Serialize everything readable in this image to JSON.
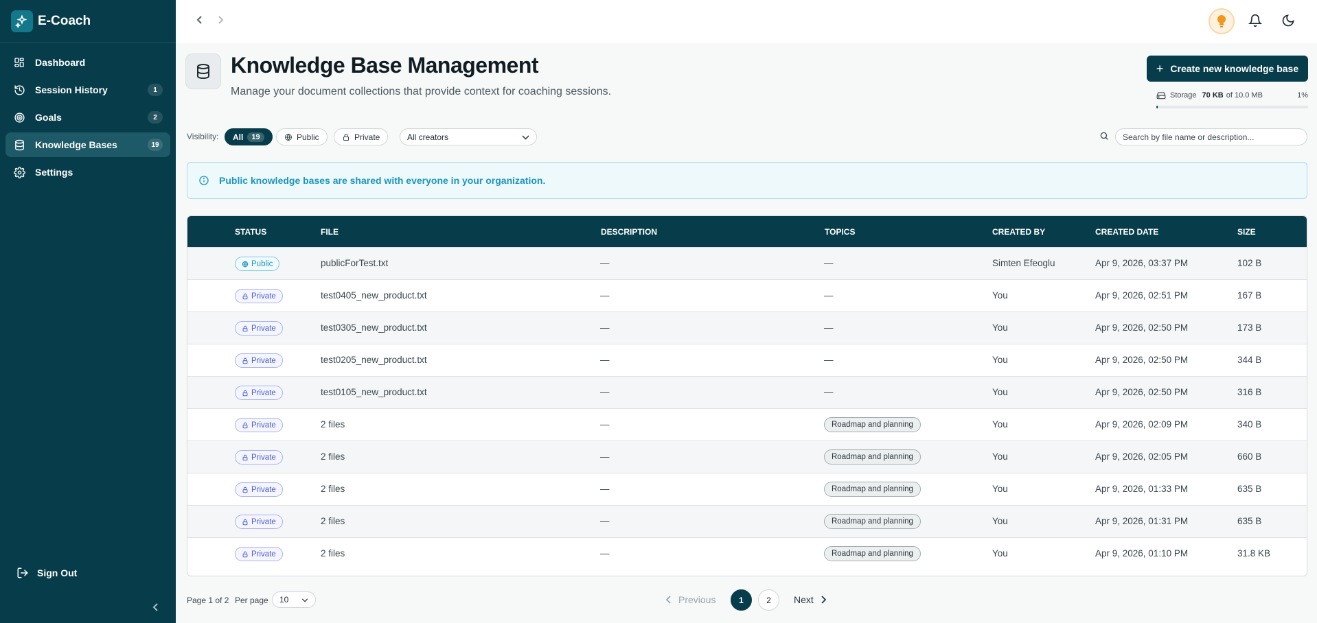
{
  "app": {
    "name": "E-Coach"
  },
  "sidebar": {
    "items": [
      {
        "label": "Dashboard",
        "badge": ""
      },
      {
        "label": "Session History",
        "badge": "1"
      },
      {
        "label": "Goals",
        "badge": "2"
      },
      {
        "label": "Knowledge Bases",
        "badge": "19"
      },
      {
        "label": "Settings",
        "badge": ""
      }
    ],
    "sign_out": "Sign Out"
  },
  "header": {
    "title": "Knowledge Base Management",
    "subtitle": "Manage your document collections that provide context for coaching sessions.",
    "create_button": "Create new knowledge base",
    "storage": {
      "label": "Storage",
      "used": "70 KB",
      "total": "of 10.0 MB",
      "percent": "1%",
      "fraction": 0.01
    }
  },
  "filters": {
    "visibility_label": "Visibility:",
    "all_label": "All",
    "all_count": "19",
    "public_label": "Public",
    "private_label": "Private",
    "creator_select": "All creators",
    "search_placeholder": "Search by file name or description..."
  },
  "banner": {
    "text": "Public knowledge bases are shared with everyone in your organization."
  },
  "table": {
    "columns": [
      "Status",
      "File",
      "Description",
      "Topics",
      "Created By",
      "Created Date",
      "Size"
    ],
    "rows": [
      {
        "status": "Public",
        "file": "publicForTest.txt",
        "description": "—",
        "topics": "—",
        "created_by": "Simten Efeoglu",
        "created_date": "Apr 9, 2026, 03:37 PM",
        "size": "102 B"
      },
      {
        "status": "Private",
        "file": "test0405_new_product.txt",
        "description": "—",
        "topics": "—",
        "created_by": "You",
        "created_date": "Apr 9, 2026, 02:51 PM",
        "size": "167 B"
      },
      {
        "status": "Private",
        "file": "test0305_new_product.txt",
        "description": "—",
        "topics": "—",
        "created_by": "You",
        "created_date": "Apr 9, 2026, 02:50 PM",
        "size": "173 B"
      },
      {
        "status": "Private",
        "file": "test0205_new_product.txt",
        "description": "—",
        "topics": "—",
        "created_by": "You",
        "created_date": "Apr 9, 2026, 02:50 PM",
        "size": "344 B"
      },
      {
        "status": "Private",
        "file": "test0105_new_product.txt",
        "description": "—",
        "topics": "—",
        "created_by": "You",
        "created_date": "Apr 9, 2026, 02:50 PM",
        "size": "316 B"
      },
      {
        "status": "Private",
        "file": "2 files",
        "description": "—",
        "topics": "Roadmap and planning",
        "created_by": "You",
        "created_date": "Apr 9, 2026, 02:09 PM",
        "size": "340 B"
      },
      {
        "status": "Private",
        "file": "2 files",
        "description": "—",
        "topics": "Roadmap and planning",
        "created_by": "You",
        "created_date": "Apr 9, 2026, 02:05 PM",
        "size": "660 B"
      },
      {
        "status": "Private",
        "file": "2 files",
        "description": "—",
        "topics": "Roadmap and planning",
        "created_by": "You",
        "created_date": "Apr 9, 2026, 01:33 PM",
        "size": "635 B"
      },
      {
        "status": "Private",
        "file": "2 files",
        "description": "—",
        "topics": "Roadmap and planning",
        "created_by": "You",
        "created_date": "Apr 9, 2026, 01:31 PM",
        "size": "635 B"
      },
      {
        "status": "Private",
        "file": "2 files",
        "description": "—",
        "topics": "Roadmap and planning",
        "created_by": "You",
        "created_date": "Apr 9, 2026, 01:10 PM",
        "size": "31.8 KB"
      }
    ]
  },
  "pagination": {
    "page_info": "Page 1 of 2",
    "per_page_label": "Per page",
    "per_page_value": "10",
    "previous": "Previous",
    "next": "Next",
    "pages": [
      "1",
      "2"
    ]
  },
  "colors": {
    "sidebar": "#073d4b",
    "accent": "#073d4b",
    "public": "#1d95bd",
    "private": "#4c5fd5"
  }
}
